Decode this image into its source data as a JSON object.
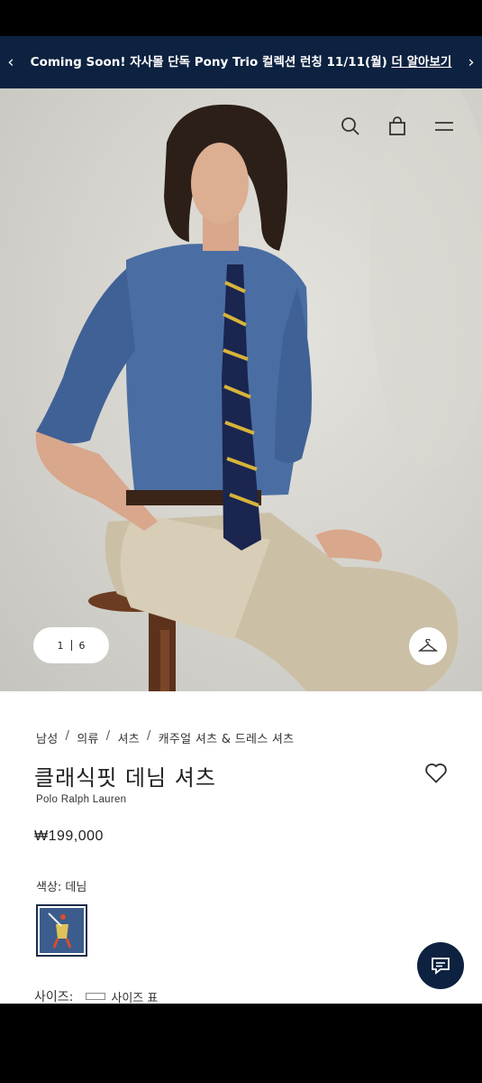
{
  "promo": {
    "message": "Coming Soon! 자사몰 단독 Pony Trio 컬렉션 런칭 11/11(월)",
    "link": "더 알아보기",
    "prev_icon": "chevron-left-icon",
    "next_icon": "chevron-right-icon"
  },
  "header_icons": [
    "search-icon",
    "shopping-bag-icon",
    "menu-icon"
  ],
  "gallery": {
    "current": "1",
    "total": "6",
    "hanger_icon": "hanger-icon"
  },
  "breadcrumb": [
    "남성",
    "의류",
    "셔츠",
    "캐주얼 셔츠 & 드레스 셔츠"
  ],
  "product": {
    "title": "클래식핏 데님 셔츠",
    "brand": "Polo Ralph Lauren",
    "price": "₩199,000",
    "color_label": "색상: 데님",
    "size_label": "사이즈:",
    "size_chart": "사이즈 표"
  },
  "colors": {
    "promo_bg": "#0d2240",
    "chat_bg": "#0d2240"
  }
}
